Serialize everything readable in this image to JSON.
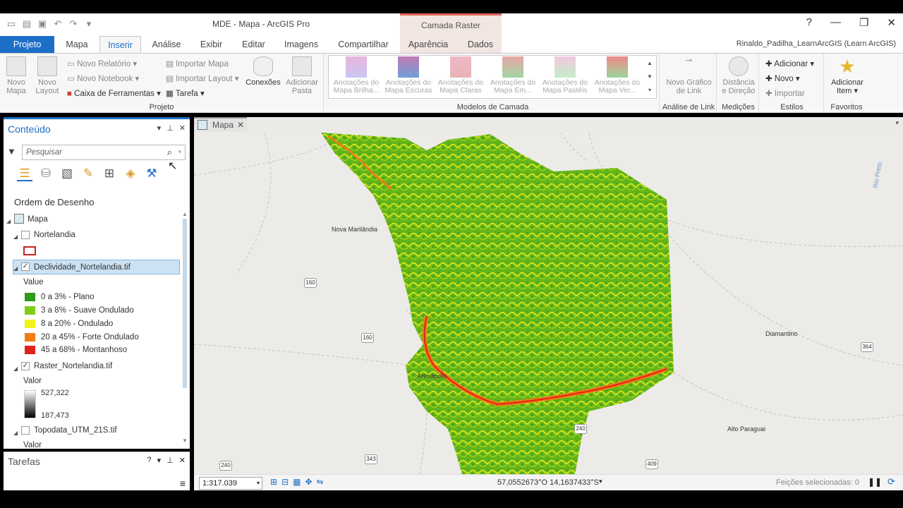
{
  "window": {
    "title": "MDE - Mapa - ArcGIS Pro",
    "context_band": "Camada Raster"
  },
  "tabs": [
    "Projeto",
    "Mapa",
    "Inserir",
    "Análise",
    "Exibir",
    "Editar",
    "Imagens",
    "Compartilhar",
    "Aparência",
    "Dados"
  ],
  "user": "Rinaldo_Padilha_LearnArcGIS (Learn ArcGIS)",
  "ribbon": {
    "projeto": {
      "label": "Projeto",
      "novo_mapa": "Novo Mapa",
      "novo_layout": "Novo Layout",
      "novo_relatorio": "Novo Relatório",
      "novo_notebook": "Novo Notebook",
      "caixa": "Caixa de Ferramentas",
      "importar_mapa": "Importar Mapa",
      "importar_layout": "Importar Layout",
      "tarefa": "Tarefa",
      "conexoes": "Conexões",
      "adicionar_pasta": "Adicionar Pasta"
    },
    "modelos": {
      "label": "Modelos de Camada",
      "items": [
        "Anotações do Mapa Brilha...",
        "Anotações do Mapa Escuras",
        "Anotações do Mapa Claras",
        "Anotações do Mapa Em...",
        "Anotações do Mapa Pastéis",
        "Anotações do Mapa Ver..."
      ]
    },
    "link": {
      "label": "Análise de Link",
      "btn": "Novo Gráfico de Link"
    },
    "med": {
      "label": "Medições",
      "btn": "Distância e Direção"
    },
    "estilos": {
      "label": "Estilos",
      "adicionar": "Adicionar",
      "novo": "Novo",
      "importar": "Importar"
    },
    "fav": {
      "label": "Favoritos",
      "btn": "Adicionar Item"
    }
  },
  "contents": {
    "title": "Conteúdo",
    "search_placeholder": "Pesquisar",
    "draw_order": "Ordem de Desenho",
    "map": "Mapa",
    "layers": [
      {
        "name": "Nortelandia"
      },
      {
        "name": "Declividade_Nortelandia.tif",
        "field": "Value",
        "classes": [
          {
            "label": "0 a 3% - Plano",
            "color": "#2e9c1a"
          },
          {
            "label": "3 a 8% - Suave Ondulado",
            "color": "#7fce16"
          },
          {
            "label": "8 a 20% - Ondulado",
            "color": "#f2f21c"
          },
          {
            "label": "20 a 45% - Forte Ondulado",
            "color": "#ef7e15"
          },
          {
            "label": "45 a 68% - Montanhoso",
            "color": "#e0231a"
          }
        ]
      },
      {
        "name": "Raster_Nortelandia.tif",
        "field": "Valor",
        "max": "527,322",
        "min": "187,473"
      },
      {
        "name": "Topodata_UTM_21S.tif",
        "field": "Valor"
      }
    ]
  },
  "tasks": {
    "title": "Tarefas"
  },
  "map_view": {
    "tab": "Mapa",
    "places": [
      "Nova Marilândia",
      "Arenápolis",
      "Diamantino",
      "Alto Paraguai",
      "Rio Preto"
    ],
    "roads": [
      "160",
      "160",
      "364",
      "240",
      "343",
      "409",
      "240"
    ],
    "scale": "1:317.039",
    "coords": "57,0552673°O 14,1637433°S",
    "selected": "Feições selecionadas: 0"
  }
}
